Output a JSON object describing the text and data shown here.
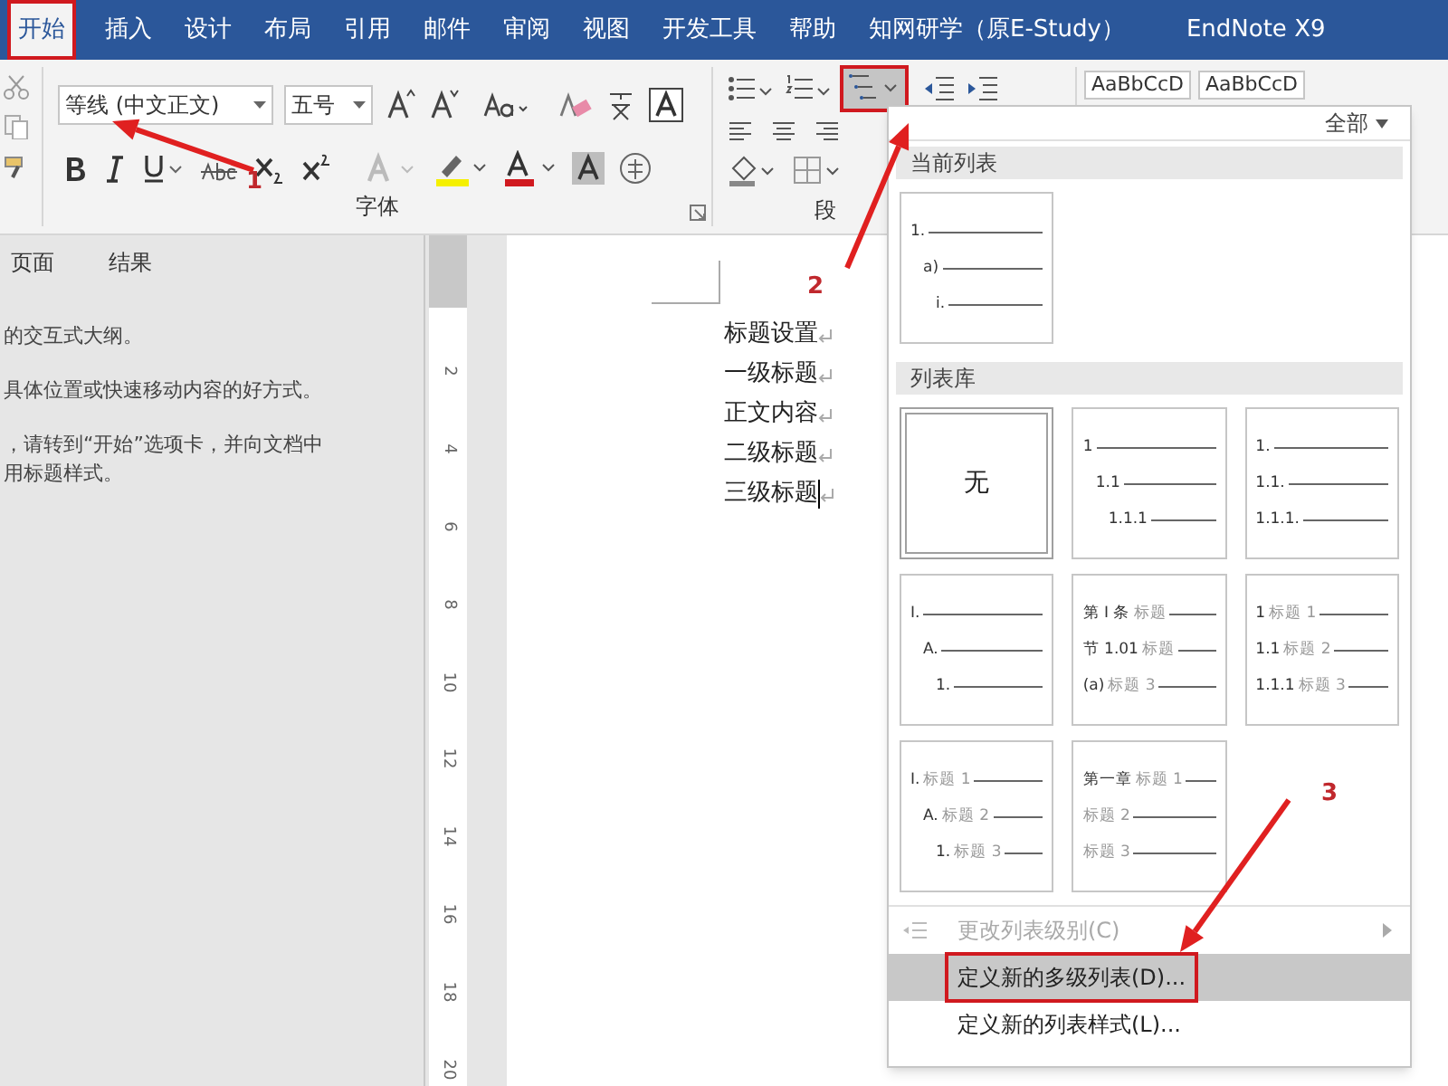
{
  "tabs": [
    {
      "label": "开始",
      "selected": true,
      "annotated": true
    },
    {
      "label": "插入",
      "selected": false,
      "annotated": false
    },
    {
      "label": "设计",
      "selected": false,
      "annotated": false
    },
    {
      "label": "布局",
      "selected": false,
      "annotated": false
    },
    {
      "label": "引用",
      "selected": false,
      "annotated": false
    },
    {
      "label": "邮件",
      "selected": false,
      "annotated": false
    },
    {
      "label": "审阅",
      "selected": false,
      "annotated": false
    },
    {
      "label": "视图",
      "selected": false,
      "annotated": false
    },
    {
      "label": "开发工具",
      "selected": false,
      "annotated": false
    },
    {
      "label": "帮助",
      "selected": false,
      "annotated": false
    },
    {
      "label": "知网研学（原E-Study）",
      "selected": false,
      "annotated": false
    },
    {
      "label": "EndNote X9",
      "selected": false,
      "annotated": false
    }
  ],
  "ribbon": {
    "font_group": {
      "label": "字体",
      "font_name": "等线 (中文正文)",
      "font_size": "五号"
    },
    "paragraph_group": {
      "label": "段",
      "multilevel_selected": true,
      "multilevel_annotated": true
    },
    "styles": [
      "AaBbCcD",
      "AaBbCcD"
    ]
  },
  "nav_pane": {
    "tabs": [
      {
        "label": "页面",
        "selected": false
      },
      {
        "label": "结果",
        "selected": false
      }
    ],
    "paragraphs": [
      {
        "lines": [
          "的交互式大纲。"
        ]
      },
      {
        "lines": [
          "具体位置或快速移动内容的好方式。"
        ]
      },
      {
        "lines": [
          "，请转到“开始”选项卡，并向文档中",
          "用标题样式。"
        ]
      }
    ]
  },
  "ruler": [
    "2",
    "4",
    "6",
    "8",
    "10",
    "12",
    "14",
    "16",
    "18",
    "20"
  ],
  "document": {
    "lines": [
      {
        "text": "标题设置",
        "cursor": false
      },
      {
        "text": "一级标题",
        "cursor": false
      },
      {
        "text": "正文内容",
        "cursor": false
      },
      {
        "text": "二级标题",
        "cursor": false
      },
      {
        "text": "三级标题",
        "cursor": true
      }
    ]
  },
  "menu": {
    "filter": "全部",
    "sections": [
      {
        "title": "当前列表",
        "items": [
          {
            "kind": "stepped",
            "selected": false,
            "lines": [
              {
                "number": "1."
              },
              {
                "number": "a)"
              },
              {
                "number": "i."
              }
            ]
          }
        ]
      },
      {
        "title": "列表库",
        "items": [
          {
            "kind": "none",
            "selected": true,
            "label": "无"
          },
          {
            "kind": "stepped",
            "selected": false,
            "lines": [
              {
                "number": "1"
              },
              {
                "number": "1.1"
              },
              {
                "number": "1.1.1"
              }
            ]
          },
          {
            "kind": "flat",
            "selected": false,
            "lines": [
              {
                "number": "1."
              },
              {
                "number": "1.1."
              },
              {
                "number": "1.1.1."
              }
            ]
          },
          {
            "kind": "stepped",
            "selected": false,
            "lines": [
              {
                "number": "I."
              },
              {
                "number": "A."
              },
              {
                "number": "1."
              }
            ]
          },
          {
            "kind": "flat",
            "selected": false,
            "lines": [
              {
                "number": "第 I 条",
                "heading": "标题"
              },
              {
                "number": "节 1.01",
                "heading": "标题"
              },
              {
                "number": "(a)",
                "heading": "标题 3"
              }
            ]
          },
          {
            "kind": "flat",
            "selected": false,
            "lines": [
              {
                "number": "1",
                "heading": "标题 1"
              },
              {
                "number": "1.1",
                "heading": "标题 2"
              },
              {
                "number": "1.1.1",
                "heading": "标题 3"
              }
            ]
          },
          {
            "kind": "stepped",
            "selected": false,
            "lines": [
              {
                "number": "I.",
                "heading": "标题 1"
              },
              {
                "number": "A.",
                "heading": "标题 2"
              },
              {
                "number": "1.",
                "heading": "标题 3"
              }
            ]
          },
          {
            "kind": "flat",
            "selected": false,
            "lines": [
              {
                "number": "第一章",
                "heading": "标题 1"
              },
              {
                "heading": "标题 2"
              },
              {
                "heading": "标题 3"
              }
            ]
          }
        ]
      }
    ],
    "commands": [
      {
        "label": "更改列表级别(C)",
        "disabled": true,
        "submenu": true,
        "highlighted": false,
        "annotated": false
      },
      {
        "label": "定义新的多级列表(D)...",
        "disabled": false,
        "submenu": false,
        "highlighted": true,
        "annotated": true
      },
      {
        "label": "定义新的列表样式(L)...",
        "disabled": false,
        "submenu": false,
        "highlighted": false,
        "annotated": false
      }
    ]
  },
  "annotations": [
    {
      "label": "1"
    },
    {
      "label": "2"
    },
    {
      "label": "3"
    }
  ]
}
